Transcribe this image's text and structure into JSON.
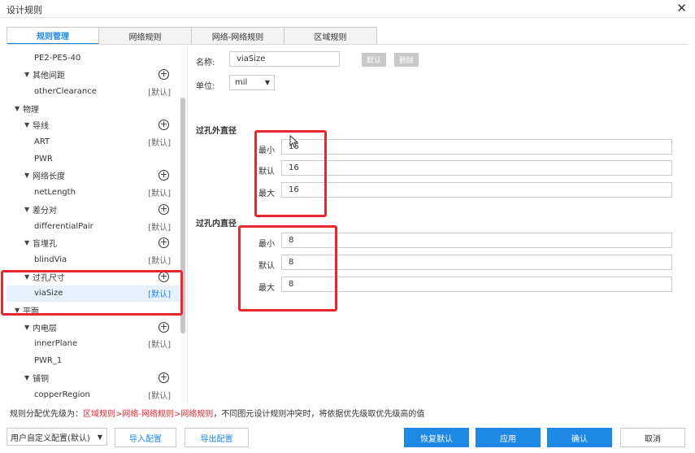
{
  "window": {
    "title": "设计规则"
  },
  "tabs": [
    "规则管理",
    "网络规则",
    "网络-网络规则",
    "区域规则"
  ],
  "tree": [
    {
      "label": "PE2-PE5-40",
      "caret": false,
      "indent": 2
    },
    {
      "label": "其他间距",
      "caret": true,
      "indent": 1,
      "plus": true
    },
    {
      "label": "otherClearance",
      "caret": false,
      "indent": 2,
      "tag": "[默认]"
    },
    {
      "label": "物理",
      "caret": true,
      "indent": 0
    },
    {
      "label": "导线",
      "caret": true,
      "indent": 1,
      "plus": true
    },
    {
      "label": "ART",
      "caret": false,
      "indent": 2,
      "tag": "[默认]"
    },
    {
      "label": "PWR",
      "caret": false,
      "indent": 2
    },
    {
      "label": "网络长度",
      "caret": true,
      "indent": 1,
      "plus": true
    },
    {
      "label": "netLength",
      "caret": false,
      "indent": 2,
      "tag": "[默认]"
    },
    {
      "label": "差分对",
      "caret": true,
      "indent": 1,
      "plus": true
    },
    {
      "label": "differentialPair",
      "caret": false,
      "indent": 2,
      "tag": "[默认]"
    },
    {
      "label": "盲埋孔",
      "caret": true,
      "indent": 1,
      "plus": true
    },
    {
      "label": "blindVia",
      "caret": false,
      "indent": 2,
      "tag": "[默认]"
    },
    {
      "label": "过孔尺寸",
      "caret": true,
      "indent": 1,
      "plus": true
    },
    {
      "label": "viaSize",
      "caret": false,
      "indent": 2,
      "tag": "[默认]",
      "selected": true
    },
    {
      "label": "平面",
      "caret": true,
      "indent": 0
    },
    {
      "label": "内电层",
      "caret": true,
      "indent": 1,
      "plus": true
    },
    {
      "label": "innerPlane",
      "caret": false,
      "indent": 2,
      "tag": "[默认]"
    },
    {
      "label": "PWR_1",
      "caret": false,
      "indent": 2
    },
    {
      "label": "铺铜",
      "caret": true,
      "indent": 1,
      "plus": true
    },
    {
      "label": "copperRegion",
      "caret": false,
      "indent": 2,
      "tag": "[默认]"
    }
  ],
  "form": {
    "name_label": "名称:",
    "name_value": "viaSize",
    "default_btn": "默认",
    "delete_btn": "删除",
    "unit_label": "单位:",
    "unit_value": "mil",
    "outer": {
      "title": "过孔外直径",
      "min_label": "最小",
      "min_value": "16",
      "def_label": "默认",
      "def_value": "16",
      "max_label": "最大",
      "max_value": "16"
    },
    "inner": {
      "title": "过孔内直径",
      "min_label": "最小",
      "min_value": "8",
      "def_label": "默认",
      "def_value": "8",
      "max_label": "最大",
      "max_value": "8"
    }
  },
  "footer": {
    "note_prefix": "规则分配优先级为：",
    "note_priority": "区域规则>网络-网络规则>网络规则",
    "note_suffix": "，不同图元设计规则冲突时，将依据优先级取优先级高的值",
    "config_value": "用户自定义配置(默认)",
    "import_btn": "导入配置",
    "export_btn": "导出配置",
    "restore_btn": "恢复默认",
    "apply_btn": "应用",
    "ok_btn": "确认",
    "cancel_btn": "取消"
  },
  "colors": {
    "accent": "#1e88e5",
    "highlight": "#e8272b"
  }
}
